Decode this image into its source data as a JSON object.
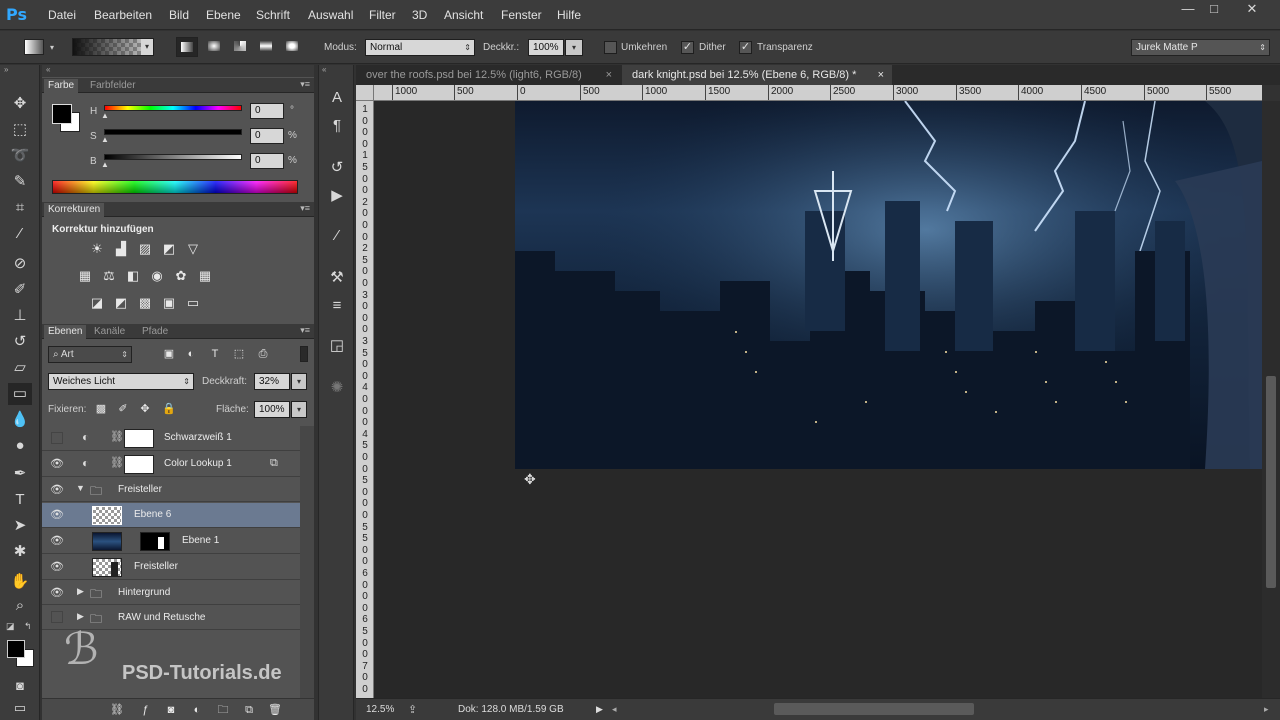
{
  "app": {
    "logo": "Ps"
  },
  "menu": [
    "Datei",
    "Bearbeiten",
    "Bild",
    "Ebene",
    "Schrift",
    "Auswahl",
    "Filter",
    "3D",
    "Ansicht",
    "Fenster",
    "Hilfe"
  ],
  "window_buttons": {
    "minimize": "—",
    "maximize": "□",
    "close": "✕"
  },
  "options": {
    "mode_label": "Modus:",
    "mode_value": "Normal",
    "opacity_label": "Deckkr.:",
    "opacity_value": "100%",
    "invert_label": "Umkehren",
    "dither_label": "Dither",
    "transparency_label": "Transparenz",
    "workspace_value": "Jurek Matte P",
    "invert_checked": false,
    "dither_checked": true,
    "transparency_checked": true
  },
  "color_panel": {
    "tab_active": "Farbe",
    "tab_other": "Farbfelder",
    "h_label": "H",
    "s_label": "S",
    "b_label": "B",
    "h_value": "0",
    "s_value": "0",
    "b_value": "0",
    "h_unit": "°",
    "s_unit": "%",
    "b_unit": "%"
  },
  "adjust_panel": {
    "tab": "Korrekturen",
    "title": "Korrektur hinzufügen"
  },
  "layers_panel": {
    "tab_active": "Ebenen",
    "tab2": "Kanäle",
    "tab3": "Pfade",
    "filter_value": "Art",
    "blend_value": "Weiches Licht",
    "opacity_label": "Deckkraft:",
    "opacity_value": "32%",
    "lock_label": "Fixieren:",
    "fill_label": "Fläche:",
    "fill_value": "100%",
    "layers": [
      {
        "name": "Schwarzweiß 1",
        "visible": false
      },
      {
        "name": "Color Lookup 1",
        "visible": true
      },
      {
        "name": "Freisteller",
        "visible": true
      },
      {
        "name": "Ebene 6",
        "visible": true,
        "selected": true
      },
      {
        "name": "Ebene 1",
        "visible": true
      },
      {
        "name": "Freisteller",
        "visible": true
      },
      {
        "name": "Hintergrund",
        "visible": true
      },
      {
        "name": "RAW und Retusche",
        "visible": false
      }
    ]
  },
  "watermark": "PSD-Tutorials.de",
  "doc_tabs": [
    {
      "label": "over the roofs.psd bei 12.5% (light6, RGB/8)",
      "close": "×"
    },
    {
      "label": "dark knight.psd bei 12.5% (Ebene 6, RGB/8) *",
      "close": "×"
    }
  ],
  "ruler_h": [
    "1000",
    "500",
    "0",
    "500",
    "1000",
    "1500",
    "2000",
    "2500",
    "3000",
    "3500",
    "4000",
    "4500",
    "5000",
    "5500"
  ],
  "ruler_v": [
    "1",
    "0",
    "0",
    "0",
    "1",
    "5",
    "0",
    "0",
    "2",
    "0",
    "0",
    "0",
    "2",
    "5",
    "0",
    "0",
    "3",
    "0",
    "0",
    "0",
    "3",
    "5",
    "0",
    "0",
    "4",
    "0",
    "0",
    "0",
    "4",
    "5",
    "0",
    "0",
    "5",
    "0",
    "0",
    "0",
    "5",
    "5",
    "0",
    "0",
    "6",
    "0",
    "0",
    "0",
    "6",
    "5",
    "0",
    "0",
    "7",
    "0",
    "0"
  ],
  "status": {
    "zoom": "12.5%",
    "doc": "Dok: 128.0 MB/1.59 GB"
  },
  "colors": {
    "accent": "#31a8ff",
    "selected": "#6b7a91"
  }
}
